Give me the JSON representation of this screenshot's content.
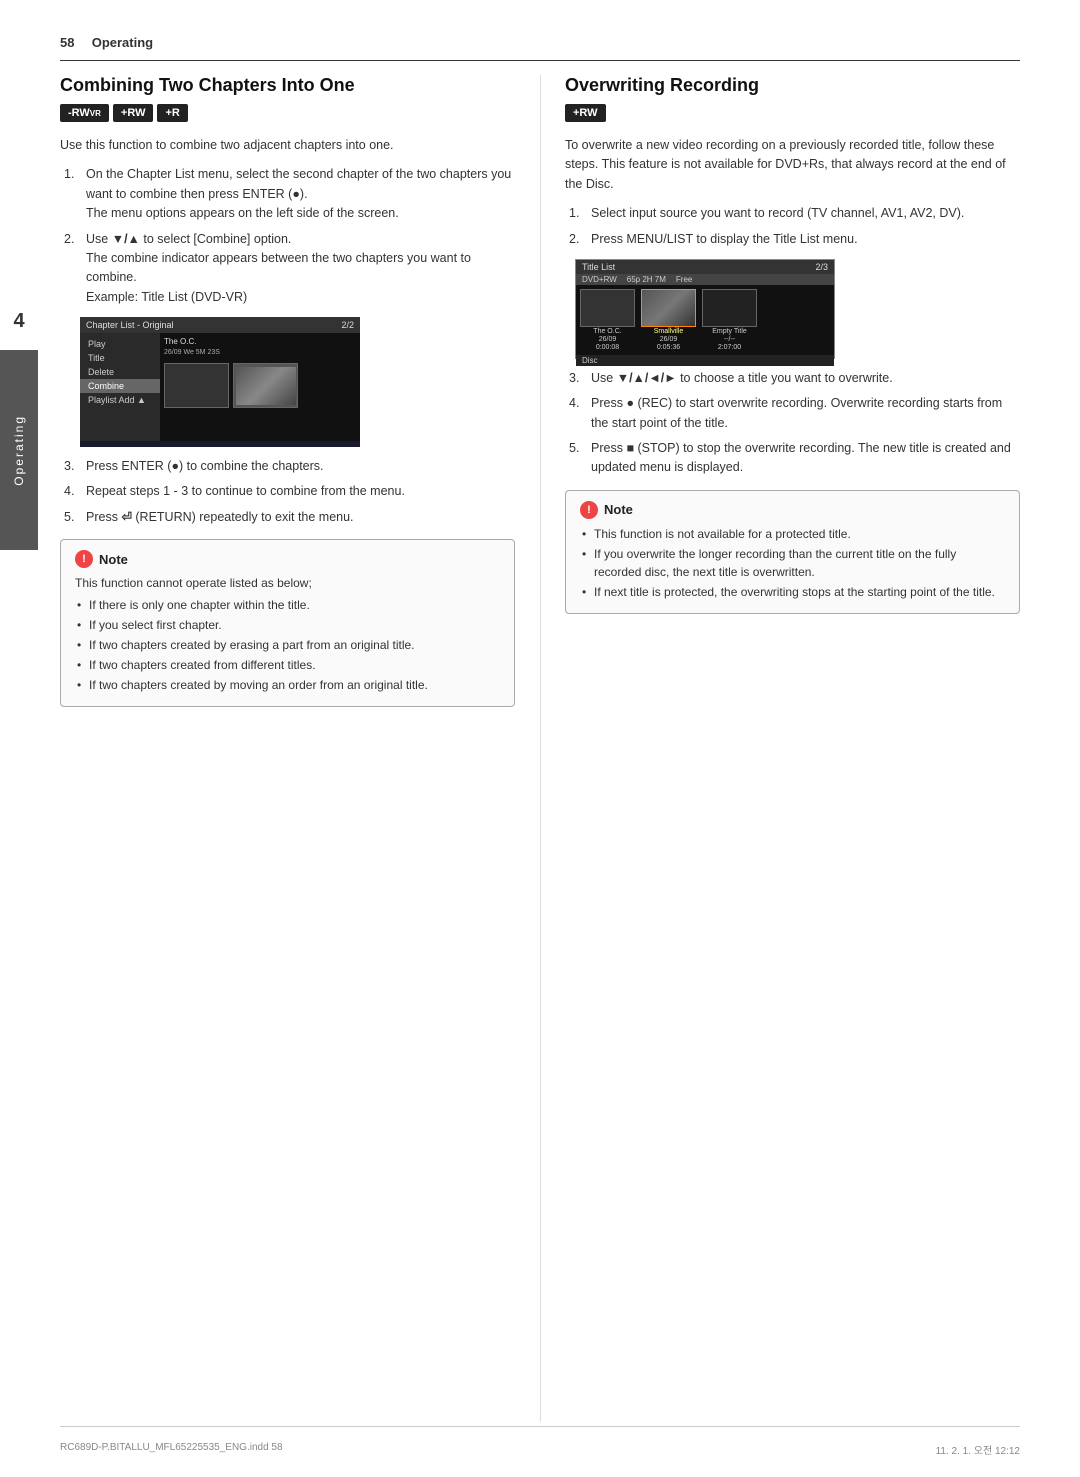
{
  "header": {
    "page_number": "58",
    "section": "Operating"
  },
  "left_section": {
    "title": "Combining Two Chapters Into One",
    "badges": [
      {
        "id": "badge-rwvr",
        "label": "-RW",
        "sub": "VR"
      },
      {
        "id": "badge-rw",
        "label": "+RW"
      },
      {
        "id": "badge-r",
        "label": "+R"
      }
    ],
    "intro": "Use this function to combine two adjacent chapters into one.",
    "steps": [
      {
        "num": "1.",
        "text": "On the Chapter List menu, select the second chapter of the two chapters you want to combine then press ENTER (●).\nThe menu options appears on the left side of the screen."
      },
      {
        "num": "2.",
        "text": "Use ▼/▲ to select [Combine] option.\nThe combine indicator appears between the two chapters you want to combine.\nExample: Title List (DVD-VR)"
      },
      {
        "num": "3.",
        "text": "Press ENTER (●) to combine the chapters."
      },
      {
        "num": "4.",
        "text": "Repeat steps 1 - 3 to continue to combine from the menu."
      },
      {
        "num": "5.",
        "text": "Press ⏎ (RETURN) repeatedly to exit the menu."
      }
    ],
    "chapter_list_header_left": "Chapter List - Original",
    "chapter_list_header_right": "2/2",
    "chapter_list_title": "The O.C.",
    "chapter_list_date": "26/09 We  5M 23S",
    "chapter_menu_items": [
      "Play",
      "Title",
      "Delete",
      "Combine",
      "Playlist Add ▲"
    ],
    "note": {
      "header": "Note",
      "first_line": "This function cannot operate listed as below;",
      "bullets": [
        "If there is only one chapter within the title.",
        "If you select first chapter.",
        "If two chapters created by erasing a part from an original title.",
        "If two chapters created from different titles.",
        "If two chapters created by moving an order from an original title."
      ]
    }
  },
  "right_section": {
    "title": "Overwriting Recording",
    "badges": [
      {
        "id": "badge-rw2",
        "label": "+RW"
      }
    ],
    "intro": "To overwrite a new video recording on a previously recorded title, follow these steps. This feature is not available for DVD+Rs, that always record at the end of the Disc.",
    "steps": [
      {
        "num": "1.",
        "text": "Select input source you want to record (TV channel, AV1, AV2, DV)."
      },
      {
        "num": "2.",
        "text": "Press MENU/LIST to display the Title List menu."
      },
      {
        "num": "3.",
        "text": "Use ▼/▲/◄/► to choose a title you want to overwrite."
      },
      {
        "num": "4.",
        "text": "Press ● (REC) to start overwrite recording. Overwrite recording starts from the start point of the title."
      },
      {
        "num": "5.",
        "text": "Press ■ (STOP) to stop the overwrite recording. The new title is created and updated menu is displayed."
      }
    ],
    "title_list_header_left": "Title List",
    "title_list_header_right": "2/3",
    "title_list_dvd_label": "DVD+RW",
    "title_list_free": "Free",
    "title_list_free_value": "65p 2H 7M",
    "title_items": [
      {
        "name": "The O.C.",
        "date": "26/09",
        "time": "0:00:08",
        "active": true
      },
      {
        "name": "Smallville",
        "date": "26/09",
        "time": "0:05:36",
        "active": false
      },
      {
        "name": "Empty Title",
        "date": "--/--",
        "time": "2:07:00",
        "active": false
      }
    ],
    "title_list_footer": "Disc",
    "note": {
      "header": "Note",
      "bullets": [
        "This function is not available for a protected title.",
        "If you overwrite the longer recording than the current title on the fully recorded disc, the next title is overwritten.",
        "If next title is protected, the overwriting stops at the starting point of the title."
      ]
    }
  },
  "side_tab": {
    "number": "4",
    "label": "Operating"
  },
  "footer": {
    "left": "RC689D-P.BITALLU_MFL65225535_ENG.indd  58",
    "right": "11. 2. 1.   오전 12:12"
  }
}
